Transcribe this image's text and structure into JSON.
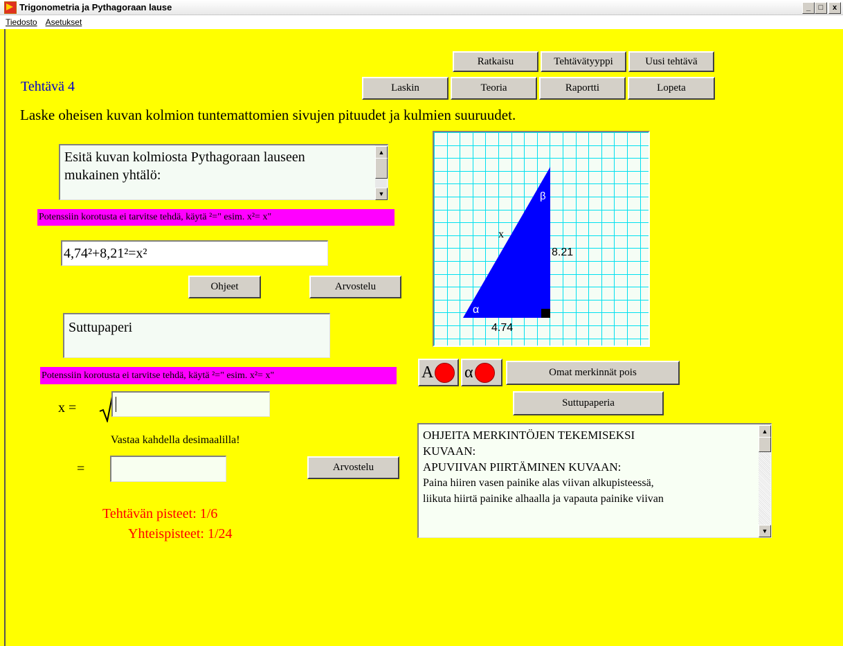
{
  "window": {
    "title": "Trigonometria ja Pythagoraan lause",
    "minimize": "_",
    "maximize": "□",
    "close": "x"
  },
  "menu": {
    "items": [
      {
        "label": "Tiedosto"
      },
      {
        "label": "Asetukset"
      }
    ]
  },
  "toolbar": {
    "ratkaisu": "Ratkaisu",
    "tehtavatyyppi": "Tehtävätyyppi",
    "uusi_tehtava": "Uusi tehtävä",
    "laskin": "Laskin",
    "teoria": "Teoria",
    "raportti": "Raportti",
    "lopeta": "Lopeta"
  },
  "task": {
    "title": "Tehtävä  4",
    "instruction": "Laske oheisen kuvan kolmion tuntemattomien sivujen pituudet ja kulmien suuruudet."
  },
  "question_box": {
    "text": "Esitä kuvan kolmiosta Pythagoraan lauseen mukainen yhtälö:"
  },
  "hint_text": "Potenssiin korotusta ei tarvitse tehdä, käytä  ²=\" esim.  x²= x\"",
  "equation_input": {
    "value": "4,74²+8,21²=x²"
  },
  "buttons": {
    "ohjeet": "Ohjeet",
    "arvostelu": "Arvostelu",
    "arvostelu2": "Arvostelu",
    "omat_merkinnat_pois": "Omat merkinnät pois",
    "suttupaperia": "Suttupaperia",
    "label_A": "A",
    "label_alpha": "α"
  },
  "scratch_box": {
    "text": "Suttupaperi"
  },
  "sqrt_row": {
    "label": "x  =",
    "value": ""
  },
  "decimal_hint": "Vastaa kahdella desimaalilla!",
  "answer_row": {
    "label": "=",
    "value": ""
  },
  "score": {
    "task_points": "Tehtävän pisteet:  1/6",
    "total_points": "Yhteispisteet:  1/24"
  },
  "figure": {
    "side_hyp": "x",
    "side_vert": "8.21",
    "side_base": "4.74",
    "angle_alpha": "α",
    "angle_beta": "β",
    "grid_color": "#00e0f0",
    "triangle_color": "#0000ff"
  },
  "instructions_box": {
    "lines": [
      "OHJEITA MERKINTÖJEN TEKEMISEKSI",
      "KUVAAN:",
      "APUVIIVAN PIIRTÄMINEN KUVAAN:",
      "Paina hiiren vasen painike alas viivan alkupisteessä,",
      "liikuta hiirtä painike alhaalla ja vapauta painike viivan"
    ]
  }
}
